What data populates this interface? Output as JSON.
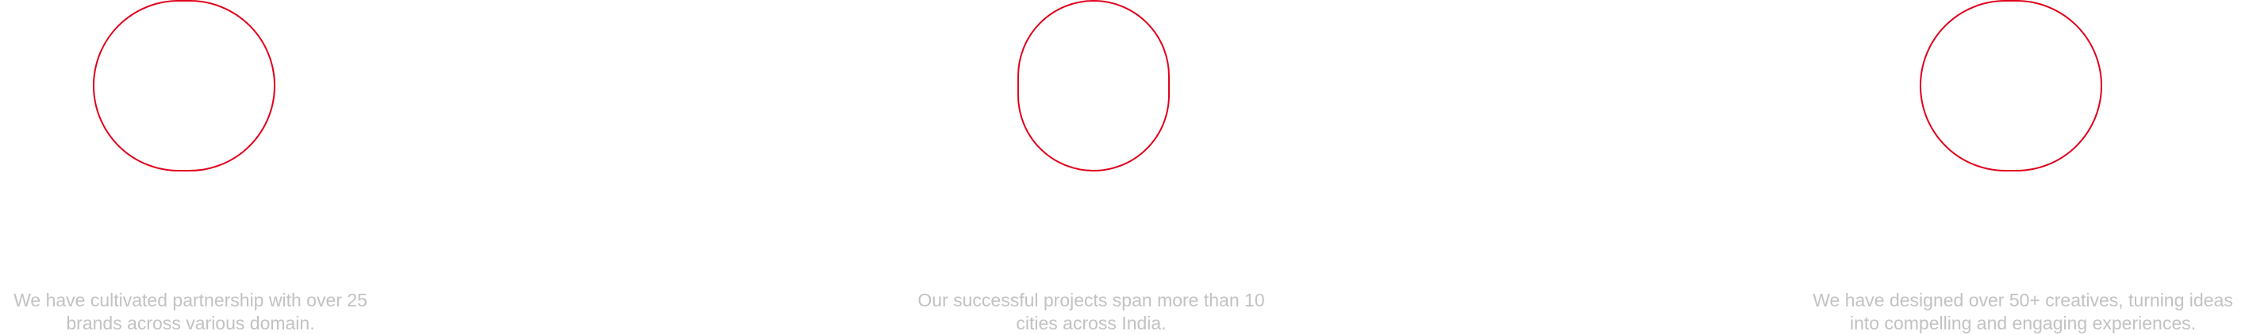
{
  "theme": {
    "accent": "#e0001b",
    "caption_color": "#c2c2c2",
    "background": "#ffffff"
  },
  "stats": [
    {
      "caption_line1": "We have cultivated partnership with over 25",
      "caption_line2": "brands across various domain."
    },
    {
      "caption_line1": "Our successful projects span more than 10",
      "caption_line2": "cities across India."
    },
    {
      "caption_line1": "We have designed over 50+ creatives, turning ideas",
      "caption_line2": "into compelling and engaging experiences."
    }
  ]
}
